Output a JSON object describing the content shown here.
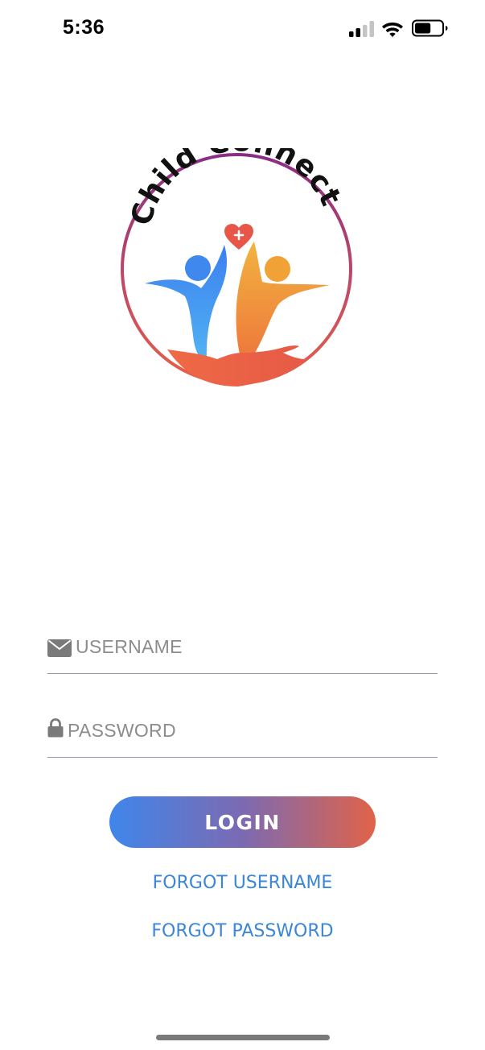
{
  "status_bar": {
    "time": "5:36",
    "icons": [
      "cellular-signal-icon",
      "wifi-icon",
      "battery-icon"
    ],
    "signal_bars_active": 2,
    "battery_level": 0.6
  },
  "logo": {
    "text": "Child Connect",
    "icon": "child-connect-logo",
    "ring_colors": [
      "#8b2d86",
      "#e05a4a"
    ]
  },
  "form": {
    "username": {
      "icon": "envelope-icon",
      "placeholder": "USERNAME",
      "value": ""
    },
    "password": {
      "icon": "lock-icon",
      "placeholder": "PASSWORD",
      "value": ""
    },
    "login_label": "LOGIN",
    "forgot_username_label": "FORGOT USERNAME",
    "forgot_password_label": "FORGOT PASSWORD"
  },
  "colors": {
    "accent_link": "#3b86d8",
    "button_gradient_start": "#3f86ea",
    "button_gradient_end": "#e06348"
  }
}
